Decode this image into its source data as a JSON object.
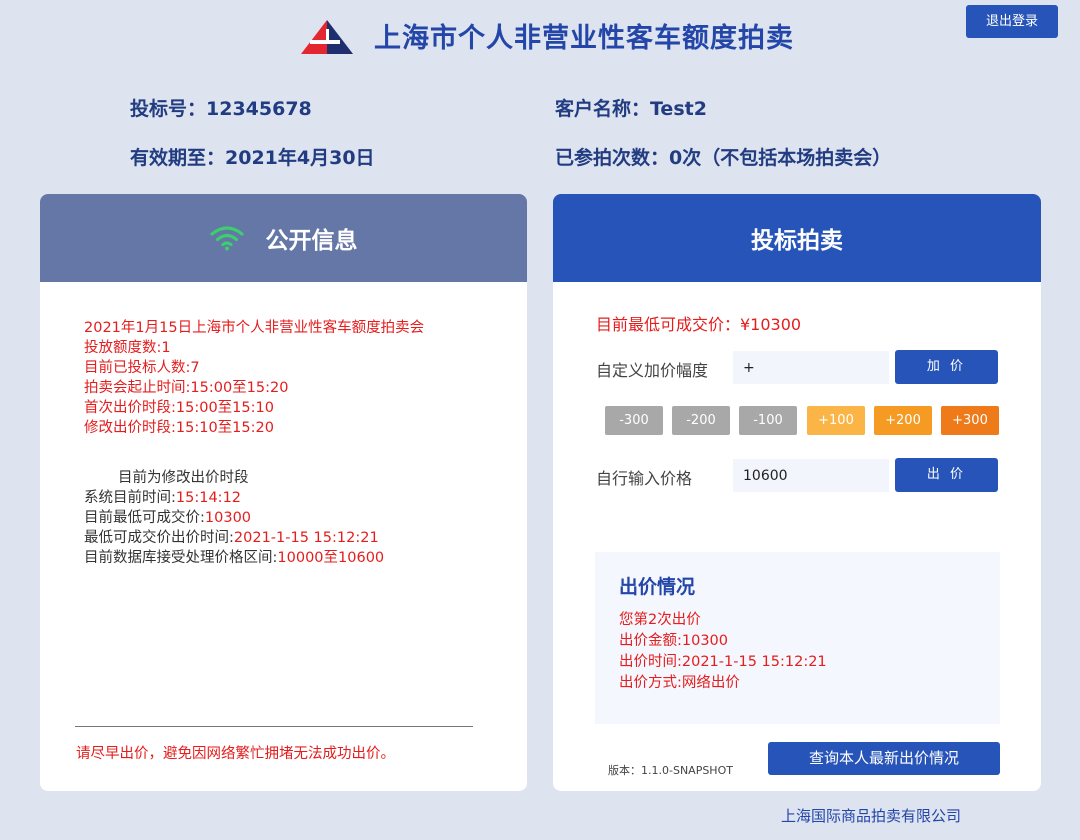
{
  "header": {
    "title": "上海市个人非营业性客车额度拍卖",
    "logout_label": "退出登录",
    "colors": {
      "brand_blue": "#2754b8",
      "logo_red": "#e3262f",
      "logo_navy": "#1f2e6d"
    }
  },
  "user_info": {
    "bid_number": "投标号：12345678",
    "customer_name": "客户名称：Test2",
    "valid_until": "有效期至：2021年4月30日",
    "auction_count": "已参拍次数：0次（不包括本场拍卖会）"
  },
  "public_panel": {
    "title": "公开信息",
    "icon": "wifi-icon",
    "red_lines": [
      "2021年1月15日上海市个人非营业性客车额度拍卖会",
      "投放额度数:1",
      "目前已投标人数:7",
      "拍卖会起止时间:15:00至15:20",
      "首次出价时段:15:00至15:10",
      "修改出价时段:15:10至15:20"
    ],
    "phase_text": "目前为修改出价时段",
    "mixed_lines": [
      {
        "label": "系统目前时间:",
        "value": "15:14:12"
      },
      {
        "label": "目前最低可成交价:",
        "value": "10300"
      },
      {
        "label": "最低可成交价出价时间:",
        "value": "2021-1-15 15:12:21"
      },
      {
        "label": "目前数据库接受处理价格区间:",
        "value": "10000至10600"
      }
    ],
    "footer_warning": "请尽早出价，避免因网络繁忙拥堵无法成功出价。"
  },
  "bid_panel": {
    "title": "投标拍卖",
    "min_price": "目前最低可成交价：¥10300",
    "custom_increment": {
      "label": "自定义加价幅度",
      "value": "+",
      "button": "加 价"
    },
    "steps": [
      {
        "label": "-300",
        "color": "#a8a8a8"
      },
      {
        "label": "-200",
        "color": "#a8a8a8"
      },
      {
        "label": "-100",
        "color": "#a8a8a8"
      },
      {
        "label": "+100",
        "color": "#fbb547"
      },
      {
        "label": "+200",
        "color": "#f59a22"
      },
      {
        "label": "+300",
        "color": "#ee7a1a"
      }
    ],
    "manual_price": {
      "label": "自行输入价格",
      "value": "10600",
      "button": "出 价"
    },
    "bid_status": {
      "title": "出价情况",
      "lines": [
        "您第2次出价",
        "出价金额:10300",
        "出价时间:2021-1-15 15:12:21",
        "出价方式:网络出价"
      ]
    },
    "version": "版本：1.1.0-SNAPSHOT",
    "query_button": "查询本人最新出价情况"
  },
  "footer": {
    "company": "上海国际商品拍卖有限公司"
  }
}
